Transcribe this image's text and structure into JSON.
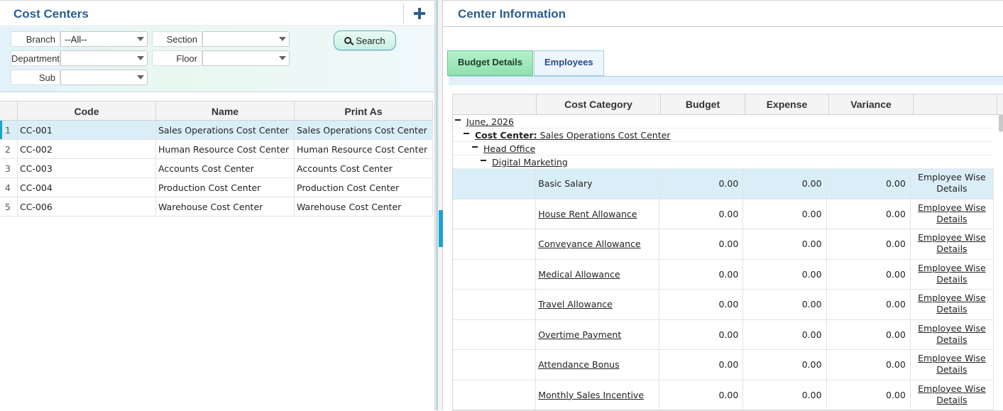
{
  "left": {
    "title": "Cost Centers",
    "add_icon": "plus-icon",
    "filters": {
      "branch": {
        "label": "Branch",
        "value": "--All--"
      },
      "department": {
        "label": "Department",
        "value": ""
      },
      "sub": {
        "label": "Sub",
        "value": ""
      },
      "section": {
        "label": "Section",
        "value": ""
      },
      "floor": {
        "label": "Floor",
        "value": ""
      }
    },
    "search_label": "Search",
    "columns": [
      "Code",
      "Name",
      "Print As"
    ],
    "rows": [
      {
        "index": "1",
        "code": "CC-001",
        "name": "Sales Operations Cost Center",
        "print_as": "Sales Operations Cost Center"
      },
      {
        "index": "2",
        "code": "CC-002",
        "name": "Human Resource Cost Center",
        "print_as": "Human Resource Cost Center"
      },
      {
        "index": "3",
        "code": "CC-003",
        "name": "Accounts Cost Center",
        "print_as": "Accounts Cost Center"
      },
      {
        "index": "4",
        "code": "CC-004",
        "name": "Production Cost Center",
        "print_as": "Production Cost Center"
      },
      {
        "index": "5",
        "code": "CC-006",
        "name": "Warehouse Cost Center",
        "print_as": "Warehouse Cost Center"
      }
    ]
  },
  "right": {
    "title": "Center Information",
    "tabs": [
      {
        "label": "Budget Details",
        "active": true
      },
      {
        "label": "Employees",
        "active": false
      }
    ],
    "columns": [
      "",
      "Cost Category",
      "Budget",
      "Expense",
      "Variance",
      ""
    ],
    "tree": {
      "period": "June, 2026",
      "cost_center_label": "Cost Center:",
      "cost_center_value": "Sales Operations Cost Center",
      "branch": "Head Office",
      "department": "Digital Marketing"
    },
    "detail_line1": "Employee Wise",
    "detail_line2": "Details",
    "rows": [
      {
        "category": "Basic Salary",
        "budget": "0.00",
        "expense": "0.00",
        "variance": "0.00"
      },
      {
        "category": "House Rent Allowance",
        "budget": "0.00",
        "expense": "0.00",
        "variance": "0.00"
      },
      {
        "category": "Conveyance Allowance",
        "budget": "0.00",
        "expense": "0.00",
        "variance": "0.00"
      },
      {
        "category": "Medical Allowance",
        "budget": "0.00",
        "expense": "0.00",
        "variance": "0.00"
      },
      {
        "category": "Travel Allowance",
        "budget": "0.00",
        "expense": "0.00",
        "variance": "0.00"
      },
      {
        "category": "Overtime Payment",
        "budget": "0.00",
        "expense": "0.00",
        "variance": "0.00"
      },
      {
        "category": "Attendance Bonus",
        "budget": "0.00",
        "expense": "0.00",
        "variance": "0.00"
      },
      {
        "category": "Monthly Sales Incentive",
        "budget": "0.00",
        "expense": "0.00",
        "variance": "0.00"
      }
    ]
  },
  "colors": {
    "title": "#2a5e8d",
    "accent": "#1aa3d4",
    "selected_row": "#daeef8",
    "active_tab": "#8fe0ae"
  }
}
